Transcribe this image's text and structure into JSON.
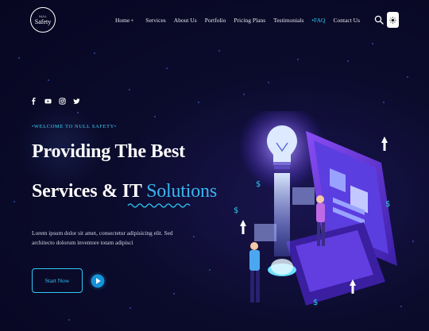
{
  "logo": {
    "small_text": "NULL",
    "brand": "Safety"
  },
  "nav": {
    "items": [
      {
        "label": "Home",
        "has_dropdown": true,
        "active": false
      },
      {
        "label": "Services",
        "active": false
      },
      {
        "label": "About Us",
        "active": false
      },
      {
        "label": "Portfolio",
        "active": false
      },
      {
        "label": "Pricing Plans",
        "active": false
      },
      {
        "label": "Testimonials",
        "active": false
      },
      {
        "label": "FAQ",
        "active": true
      },
      {
        "label": "Contact Us",
        "active": false
      }
    ]
  },
  "social": [
    "facebook-icon",
    "youtube-icon",
    "instagram-icon",
    "twitter-icon"
  ],
  "hero": {
    "tagline": "WELCOME TO NULL SAFETY",
    "title_line1": "Providing The Best",
    "title_line2_prefix": "Services & IT",
    "title_line2_highlight": "Solutions",
    "paragraph": "Lorem ipsum dolor sit amet, consectetur adipisicing elit. Sed architecto dolorum inventore totam adipisci",
    "cta_label": "Start Now"
  },
  "colors": {
    "accent": "#2ec9f5",
    "background": "#0b0b2c",
    "illustration_purple": "#6a3df0"
  }
}
